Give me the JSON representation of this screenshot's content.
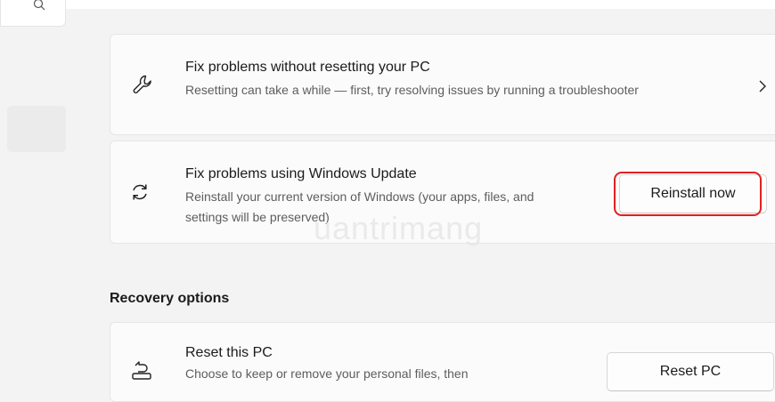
{
  "cards": {
    "fix_without_reset": {
      "title": "Fix problems without resetting your PC",
      "description": "Resetting can take a while — first, try resolving issues by running a troubleshooter"
    },
    "fix_windows_update": {
      "title": "Fix problems using Windows Update",
      "description": "Reinstall your current version of Windows (your apps, files, and settings will be preserved)",
      "button_label": "Reinstall now"
    },
    "reset_pc": {
      "title": "Reset this PC",
      "description": "Choose to keep or remove your personal files, then",
      "button_label": "Reset PC"
    }
  },
  "recovery_options_heading": "Recovery options",
  "watermark_text": "uantrimang",
  "colors": {
    "highlight": "#e02020",
    "card_background": "#fbfbfb",
    "page_background": "#f3f3f3"
  },
  "icons": {
    "search": "search-icon",
    "wrench": "wrench-icon",
    "refresh": "refresh-icon",
    "chevron": "chevron-right-icon",
    "reset": "reset-pc-icon"
  }
}
